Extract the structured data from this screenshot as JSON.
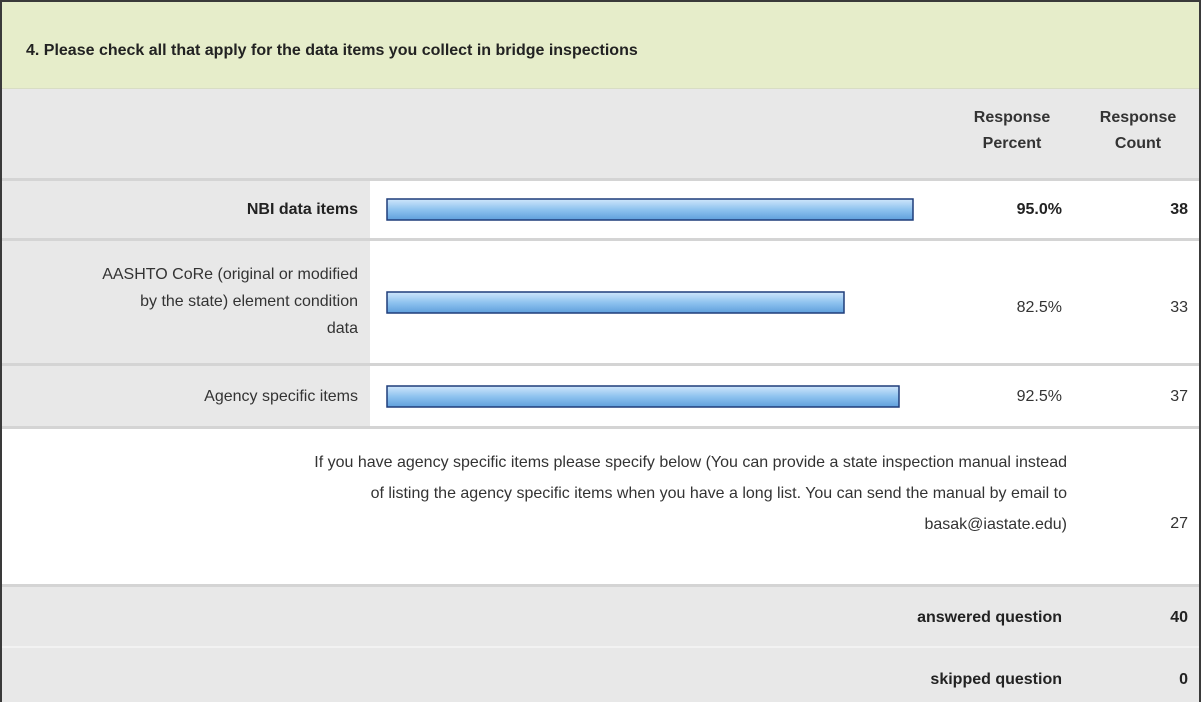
{
  "question": "4. Please check all that apply for the data items you collect in bridge inspections",
  "headers": {
    "percent_line1": "Response",
    "percent_line2": "Percent",
    "count_line1": "Response",
    "count_line2": "Count"
  },
  "chart_data": {
    "type": "bar",
    "orientation": "horizontal",
    "categories": [
      "NBI data items",
      "AASHTO CoRe (original or modified by the state) element condition data",
      "Agency specific items"
    ],
    "values": [
      95.0,
      82.5,
      92.5
    ],
    "percent_labels": [
      "95.0%",
      "82.5%",
      "92.5%"
    ],
    "counts": [
      38,
      33,
      37
    ],
    "xlim": [
      0,
      100
    ],
    "bar_color": "#8fc3ef",
    "bar_border": "#1f3d7a"
  },
  "rows": [
    {
      "label_lines": [
        "NBI data items"
      ],
      "percent": "95.0%",
      "count": "38"
    },
    {
      "label_lines": [
        "AASHTO CoRe (original or modified",
        "by the state) element condition",
        "data"
      ],
      "percent": "82.5%",
      "count": "33"
    },
    {
      "label_lines": [
        "Agency specific items"
      ],
      "percent": "92.5%",
      "count": "37"
    }
  ],
  "other": {
    "text_lines": [
      "If you have agency specific items please specify below (You can provide a state inspection manual instead",
      "of listing the agency specific items when you have a long list. You can send the manual by email to",
      "basak@iastate.edu)"
    ],
    "count": "27"
  },
  "footer": {
    "answered_label": "answered question",
    "answered_value": "40",
    "skipped_label": "skipped question",
    "skipped_value": "0"
  }
}
